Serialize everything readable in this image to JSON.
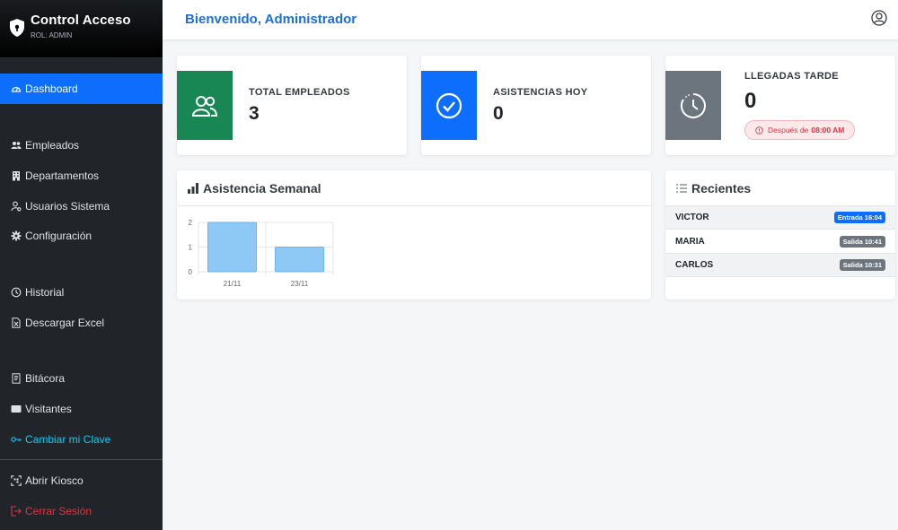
{
  "brand": {
    "title": "Control Acceso",
    "role": "ROL: ADMIN"
  },
  "nav": {
    "dashboard": "Dashboard",
    "empleados": "Empleados",
    "departamentos": "Departamentos",
    "usuarios": "Usuarios Sistema",
    "configuracion": "Configuración",
    "historial": "Historial",
    "excel": "Descargar Excel",
    "bitacora": "Bitácora",
    "visitantes": "Visitantes",
    "clave": "Cambiar mi Clave",
    "kiosco": "Abrir Kiosco",
    "logout": "Cerrar Sesión"
  },
  "header": {
    "welcome": "Bienvenido, Administrador"
  },
  "stats": {
    "empleados": {
      "label": "TOTAL EMPLEADOS",
      "value": "3"
    },
    "asistencias": {
      "label": "ASISTENCIAS HOY",
      "value": "0"
    },
    "tarde": {
      "label": "LLEGADAS TARDE",
      "value": "0",
      "note": "Después de",
      "time": "08:00 AM"
    }
  },
  "weekly": {
    "title": "Asistencia Semanal"
  },
  "chart_data": {
    "type": "bar",
    "categories": [
      "21/11",
      "23/11"
    ],
    "values": [
      2,
      1
    ],
    "ylim": [
      0,
      2
    ],
    "yticks": [
      "0",
      "1",
      "2"
    ],
    "grid": true,
    "bar_color": "#8ec8f5"
  },
  "recent": {
    "title": "Recientes",
    "items": [
      {
        "name": "VICTOR",
        "badge": "Entrada 16:04",
        "color": "#0d6efd"
      },
      {
        "name": "MARIA",
        "badge": "Salida 10:41",
        "color": "#6c757d"
      },
      {
        "name": "CARLOS",
        "badge": "Salida 10:31",
        "color": "#6c757d"
      }
    ]
  },
  "colors": {
    "primary": "#0d6efd",
    "success": "#198754",
    "secondary": "#6c757d",
    "danger": "#dc3545",
    "sidebar": "#212529"
  }
}
